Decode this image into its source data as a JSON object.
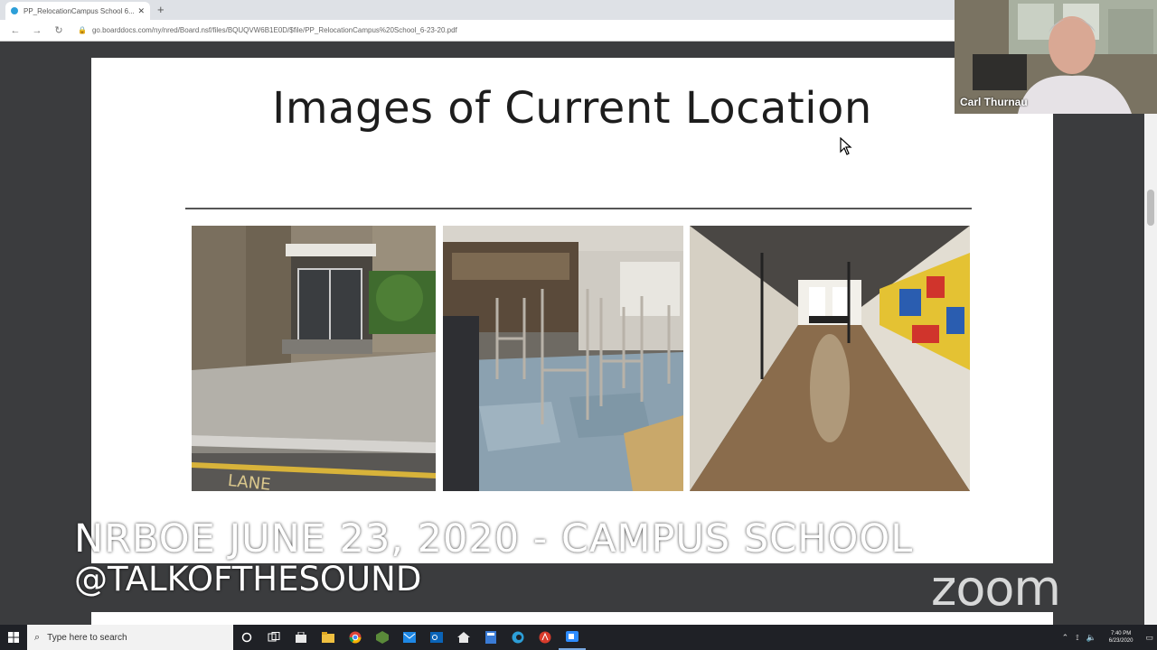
{
  "browser": {
    "tab_title": "PP_RelocationCampus School 6...",
    "close_tab": "✕",
    "new_tab": "+",
    "url": "go.boarddocs.com/ny/nred/Board.nsf/files/BQUQVW6B1E0D/$file/PP_RelocationCampus%20School_6-23-20.pdf"
  },
  "slide": {
    "title": "Images of Current Location"
  },
  "overlay": {
    "caption": "NRBOE JUNE 23, 2020 - CAMPUS SCHOOL",
    "handle": "@TALKOFTHESOUND",
    "logo": "zoom"
  },
  "webcam": {
    "participant_name": "Carl Thurnau"
  },
  "taskbar": {
    "search_placeholder": "Type here to search",
    "clock_time": "7:40 PM",
    "clock_date": "6/23/2020"
  },
  "icons": [
    "windows-start-icon",
    "cortana-icon",
    "task-view-icon",
    "store-icon",
    "file-explorer-icon",
    "chrome-icon",
    "app-icon",
    "mail-icon",
    "outlook-icon",
    "home-icon",
    "calculator-icon",
    "edge-icon",
    "acrobat-icon",
    "zoom-icon"
  ]
}
